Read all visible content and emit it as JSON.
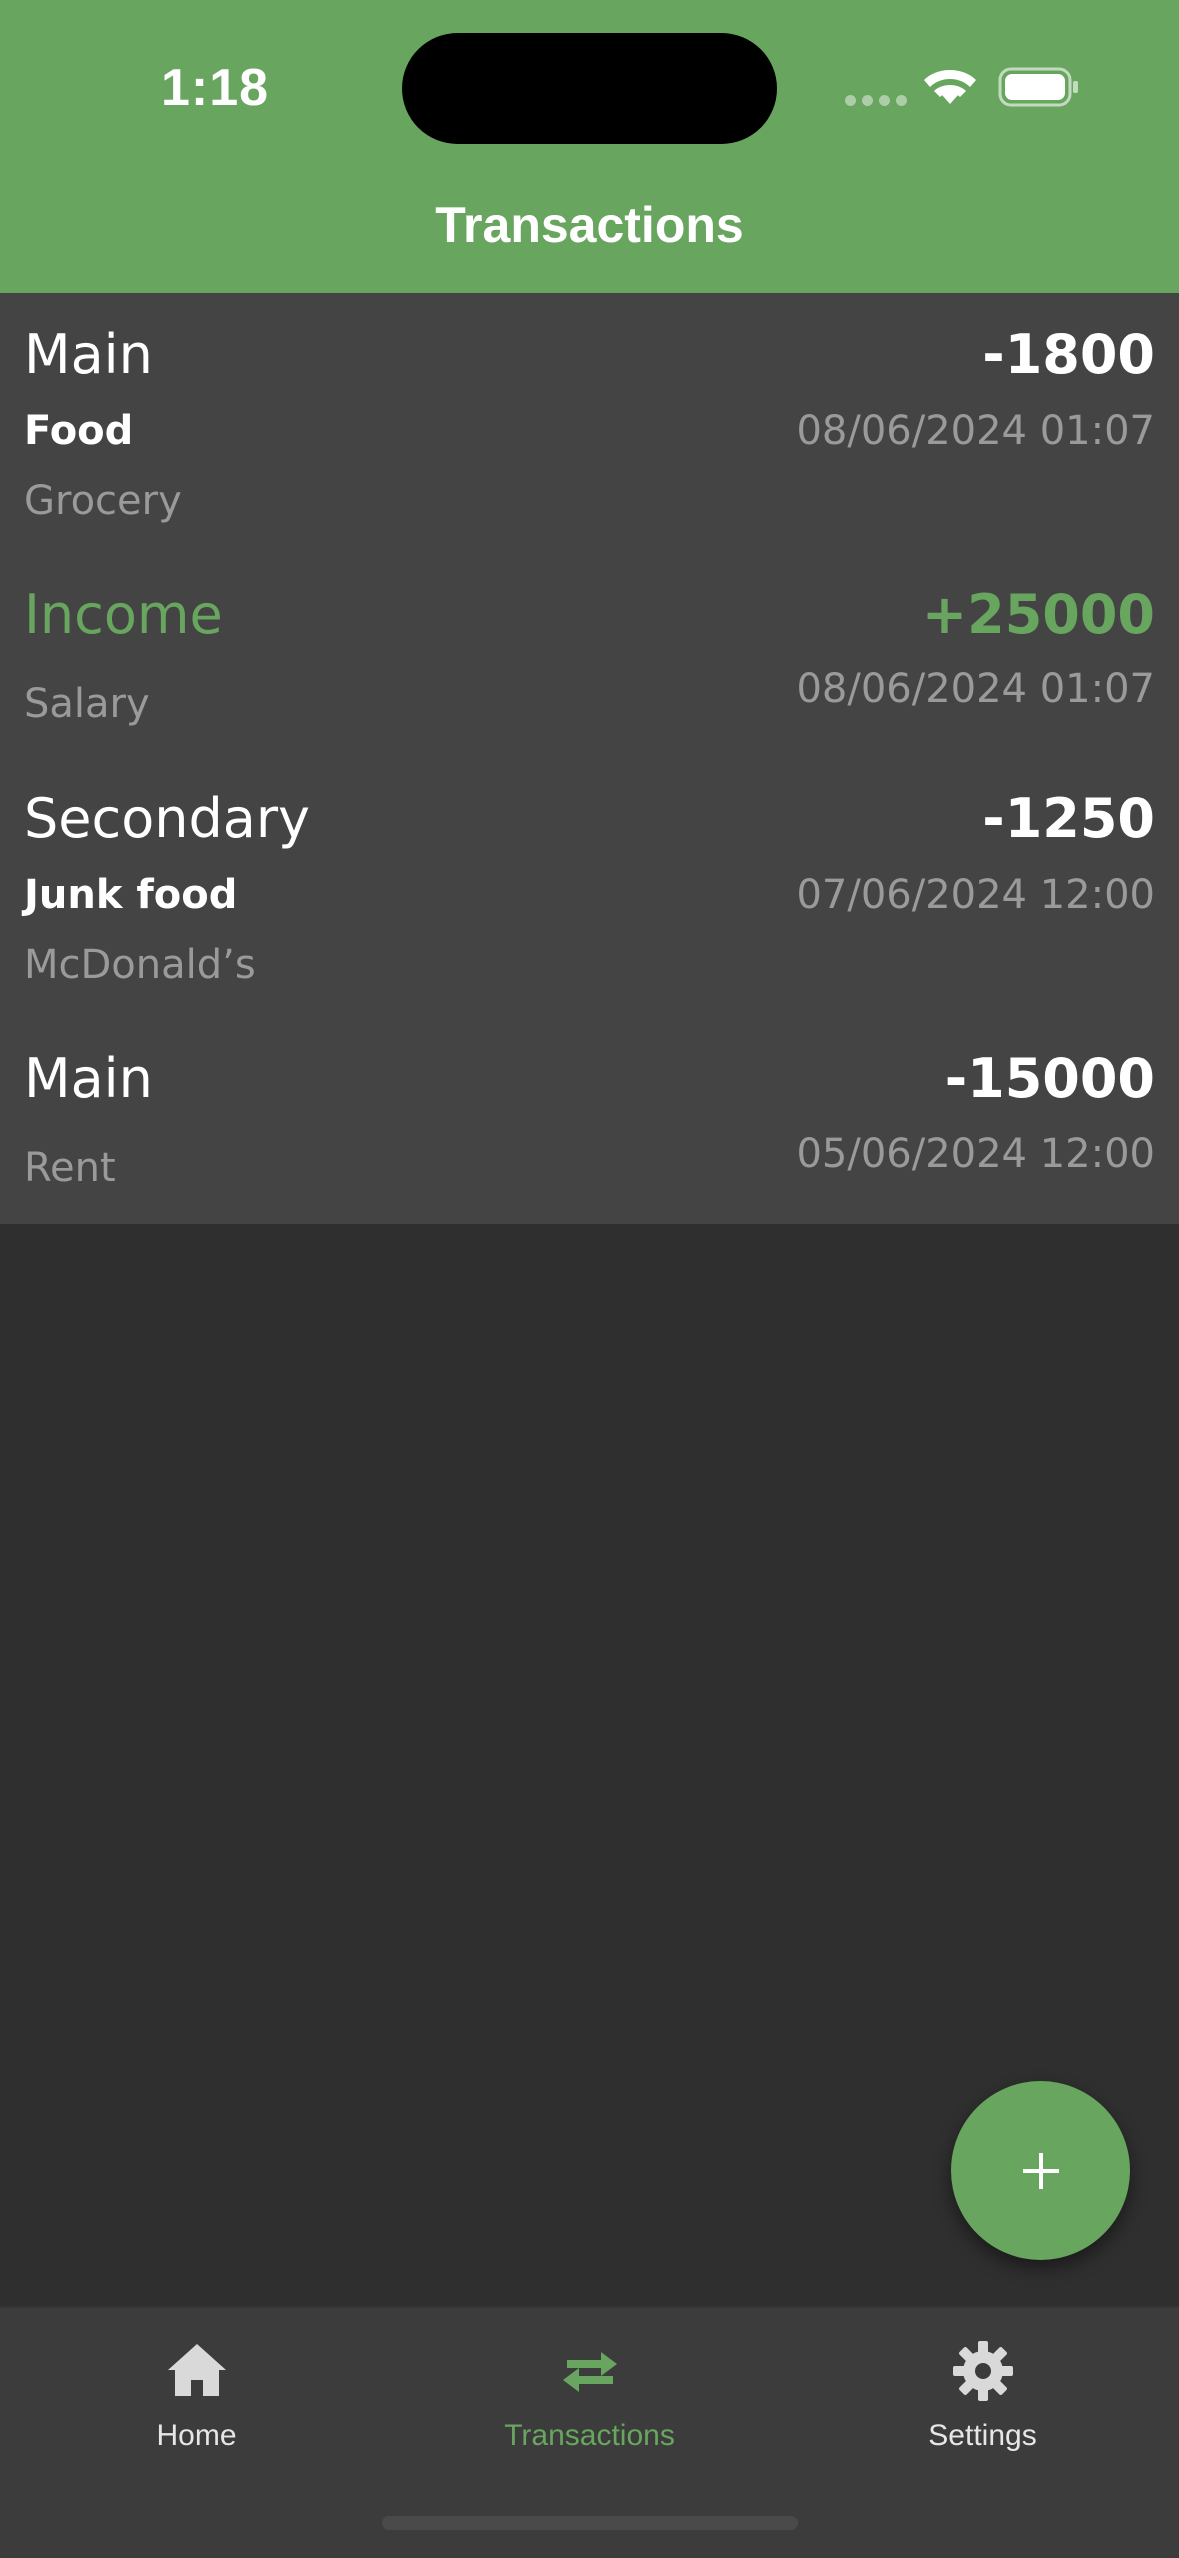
{
  "status_bar": {
    "time": "1:18"
  },
  "header": {
    "title": "Transactions"
  },
  "colors": {
    "accent": "#68a55f",
    "list_background": "#444444",
    "page_background": "#2f2f2f",
    "nav_background": "#3c3c3c"
  },
  "transactions": [
    {
      "account": "Main",
      "amount": "-1800",
      "category": "Food",
      "date": "08/06/2024 01:07",
      "note": "Grocery"
    },
    {
      "account": "Income",
      "amount": "+25000",
      "date": "08/06/2024 01:07",
      "note": "Salary"
    },
    {
      "account": "Secondary",
      "amount": "-1250",
      "category": "Junk food",
      "date": "07/06/2024 12:00",
      "note": "McDonald’s"
    },
    {
      "account": "Main",
      "amount": "-15000",
      "date": "05/06/2024 12:00",
      "note": "Rent"
    }
  ],
  "fab": {
    "icon": "plus-icon"
  },
  "bottom_nav": {
    "items": [
      {
        "label": "Home",
        "icon": "home-icon",
        "active": false
      },
      {
        "label": "Transactions",
        "icon": "transfer-arrows-icon",
        "active": true
      },
      {
        "label": "Settings",
        "icon": "gear-icon",
        "active": false
      }
    ]
  }
}
